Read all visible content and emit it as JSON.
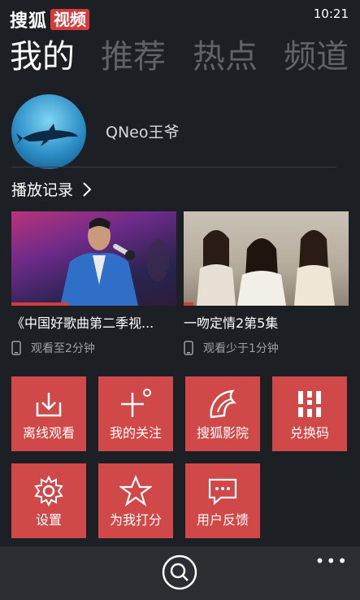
{
  "header": {
    "logo_main": "搜狐",
    "logo_badge": "视频",
    "time": "10:21"
  },
  "pivot": [
    {
      "label": "我的",
      "active": true
    },
    {
      "label": "推荐",
      "active": false
    },
    {
      "label": "热点",
      "active": false
    },
    {
      "label": "频道",
      "active": false
    }
  ],
  "profile": {
    "username": "QNeo王爷"
  },
  "history": {
    "title": "播放记录",
    "items": [
      {
        "title": "《中国好歌曲第二季视...",
        "progress_text": "观看至2分钟",
        "progress": 0.35
      },
      {
        "title": "一吻定情2第5集",
        "progress_text": "观看少于1分钟",
        "progress": 0.06
      }
    ]
  },
  "tiles": [
    {
      "label": "离线观看",
      "icon": "download-icon"
    },
    {
      "label": "我的关注",
      "icon": "add-follow-icon"
    },
    {
      "label": "搜狐影院",
      "icon": "sohu-fox-icon"
    },
    {
      "label": "兑换码",
      "icon": "qr-code-icon"
    },
    {
      "label": "设置",
      "icon": "gear-icon"
    },
    {
      "label": "为我打分",
      "icon": "star-icon"
    },
    {
      "label": "用户反馈",
      "icon": "message-icon"
    }
  ],
  "appbar": {
    "more": "•••"
  },
  "colors": {
    "accent": "#d04848",
    "background": "#1c1f23",
    "appbar": "#2a2e33"
  }
}
